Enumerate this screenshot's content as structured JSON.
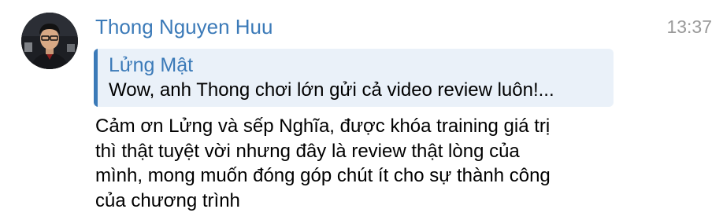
{
  "message": {
    "sender": "Thong Nguyen Huu",
    "time": "13:37",
    "reply": {
      "author": "Lửng Mật",
      "preview": "Wow, anh Thong chơi lớn gửi cả video review luôn!..."
    },
    "text_lines": [
      "Cảm ơn Lửng và sếp Nghĩa, được khóa training giá trị",
      "thì thật tuyệt vời nhưng đây là review thật lòng của",
      "mình, mong muốn đóng góp chút ít cho sự thành công",
      "của chương trình"
    ]
  },
  "colors": {
    "accent": "#3b7ab8",
    "quote_background": "#eaf1f9",
    "timestamp": "#999999",
    "text": "#000000",
    "background": "#ffffff"
  },
  "icons": {
    "avatar": "user-photo-avatar"
  }
}
